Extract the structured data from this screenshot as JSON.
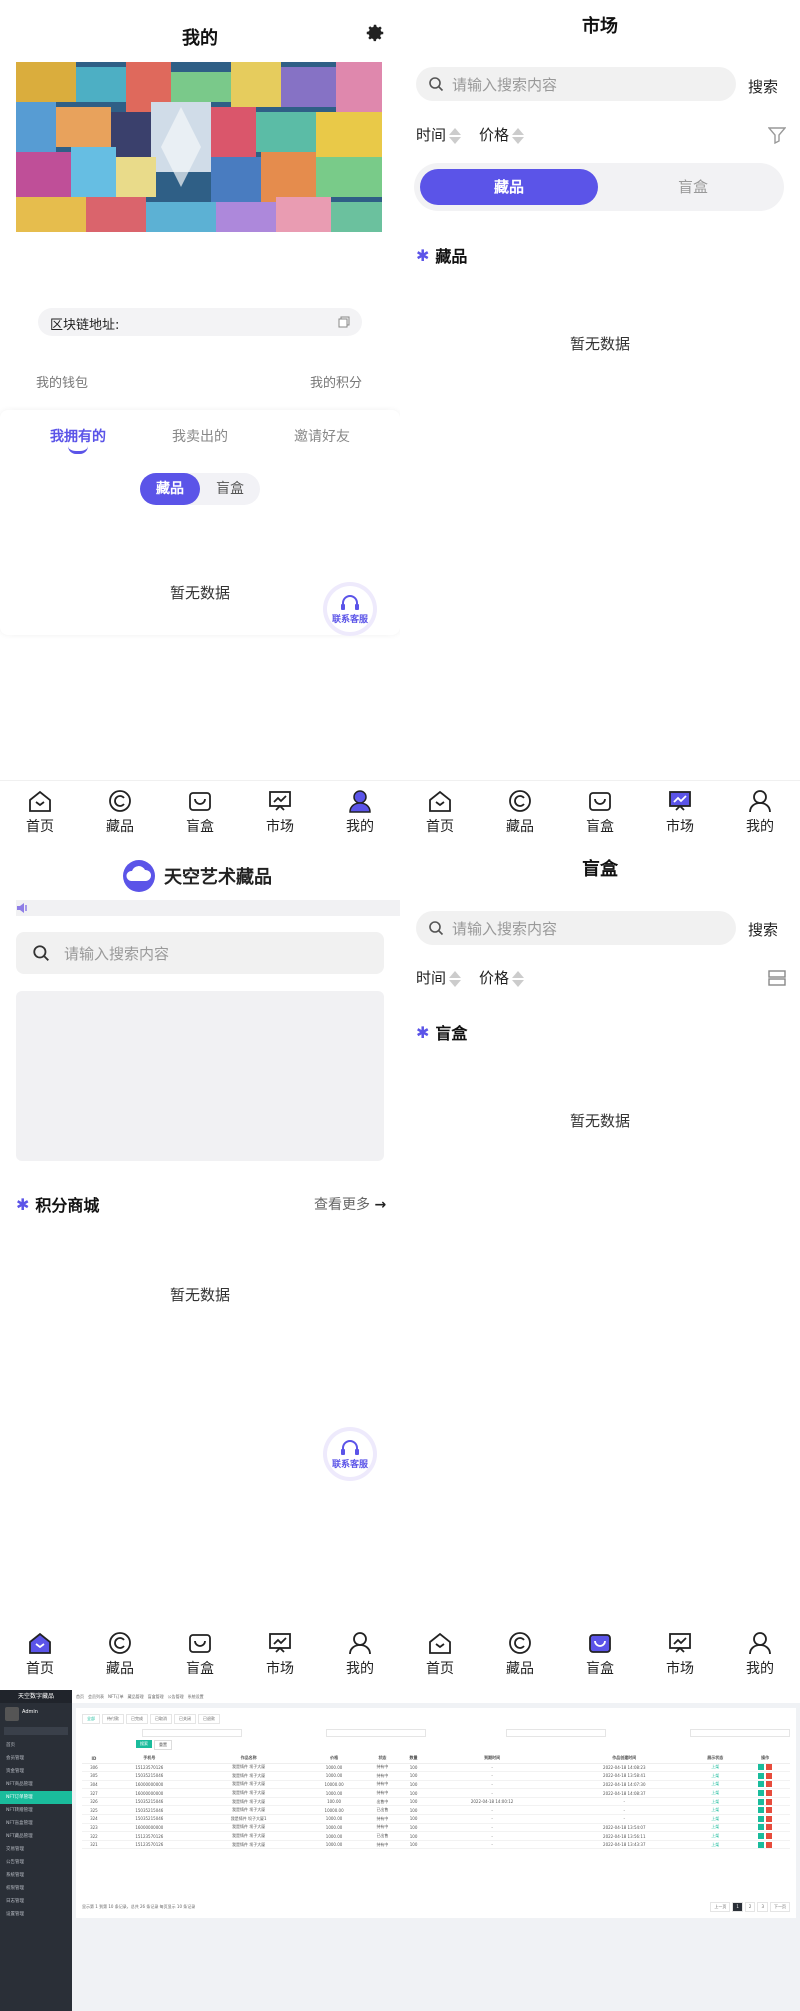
{
  "nav_labels": {
    "home": "首页",
    "collections": "藏品",
    "blindbox": "盲盒",
    "market": "市场",
    "mine": "我的"
  },
  "mine": {
    "title": "我的",
    "address_label": "区块链地址:",
    "wallet": "我的钱包",
    "points": "我的积分",
    "tabs": [
      "我拥有的",
      "我卖出的",
      "邀请好友"
    ],
    "seg": [
      "藏品",
      "盲盒"
    ],
    "empty": "暂无数据",
    "cs_label": "联系客服"
  },
  "market": {
    "title": "市场",
    "search_placeholder": "请输入搜索内容",
    "search_btn": "搜索",
    "sort_time": "时间",
    "sort_price": "价格",
    "seg": [
      "藏品",
      "盲盒"
    ],
    "section": "藏品",
    "empty": "暂无数据"
  },
  "home": {
    "brand": "天空艺术藏品",
    "search_placeholder": "请输入搜索内容",
    "section": "积分商城",
    "more": "查看更多",
    "empty": "暂无数据",
    "cs_label": "联系客服"
  },
  "blindbox": {
    "title": "盲盒",
    "search_placeholder": "请输入搜索内容",
    "search_btn": "搜索",
    "sort_time": "时间",
    "sort_price": "价格",
    "section": "盲盒",
    "empty": "暂无数据"
  },
  "admin": {
    "brand": "天空数字藏品",
    "user": "Admin",
    "menu": [
      "首页",
      "会员管理",
      "资金管理",
      "NFT商品管理",
      "NFT订单管理",
      "NFT转赠管理",
      "NFT盲盒管理",
      "NFT藏品管理",
      "交易管理",
      "公告管理",
      "系统管理",
      "权限管理",
      "日志管理",
      "设置管理"
    ],
    "tabs": [
      "首页",
      "会员列表",
      "NFT订单",
      "藏品管理",
      "盲盒管理",
      "公告管理",
      "系统设置"
    ],
    "filter_tabs": [
      "全部",
      "待付款",
      "已完成",
      "已取消",
      "已关闭",
      "已退款"
    ],
    "btn_search": "搜索",
    "btn_reset": "重置",
    "columns": [
      "ID",
      "手机号",
      "作品名称",
      "价格",
      "状态",
      "数量",
      "到期时间",
      "作品创建时间",
      "展示状态",
      "操作"
    ],
    "rows": [
      [
        "306",
        "15123570126",
        "我是铸件 坝子大厦",
        "1000.00",
        "持有中",
        "100",
        "-",
        "2022-04-18 14:08:23",
        "上架"
      ],
      [
        "305",
        "15035215046",
        "我是铸件 坝子大厦",
        "1000.00",
        "持有中",
        "100",
        "-",
        "2022-04-18 13:58:41",
        "上架"
      ],
      [
        "304",
        "16000000000",
        "我是铸件 坝子大厦",
        "10000.00",
        "持有中",
        "100",
        "-",
        "2022-04-18 14:07:30",
        "上架"
      ],
      [
        "327",
        "16000000000",
        "我是铸件 坝子大厦",
        "1000.00",
        "持有中",
        "100",
        "-",
        "2022-04-18 14:08:37",
        "上架"
      ],
      [
        "326",
        "15035215046",
        "我是铸件 坝子大厦",
        "100.00",
        "出售中",
        "100",
        "2022-04-18 14:00:12",
        "-",
        "上架"
      ],
      [
        "325",
        "15035215046",
        "我是铸件 坝子大厦",
        "10000.00",
        "已出售",
        "100",
        "-",
        "-",
        "上架"
      ],
      [
        "324",
        "15035215046",
        "我是铸件 坝子大厦1",
        "1000.00",
        "持有中",
        "100",
        "-",
        "-",
        "上架"
      ],
      [
        "323",
        "16000000000",
        "我是铸件 坝子大厦",
        "1000.00",
        "持有中",
        "100",
        "-",
        "2022-04-18 13:54:07",
        "上架"
      ],
      [
        "322",
        "15123570126",
        "我是铸件 坝子大厦",
        "1000.00",
        "已出售",
        "100",
        "-",
        "2022-04-18 13:56:11",
        "上架"
      ],
      [
        "321",
        "15123570126",
        "我是铸件 坝子大厦",
        "1000.00",
        "持有中",
        "100",
        "-",
        "2022-04-18 13:43:37",
        "上架"
      ]
    ],
    "footer": "显示第 1 到第 10 条记录，总共 26 条记录 每页显示 10 条记录",
    "pager": [
      "上一页",
      "1",
      "2",
      "3",
      "下一页"
    ]
  },
  "colors": {
    "accent": "#5b54e8",
    "admin_green": "#1abc9c",
    "admin_side": "#2a2f37"
  }
}
